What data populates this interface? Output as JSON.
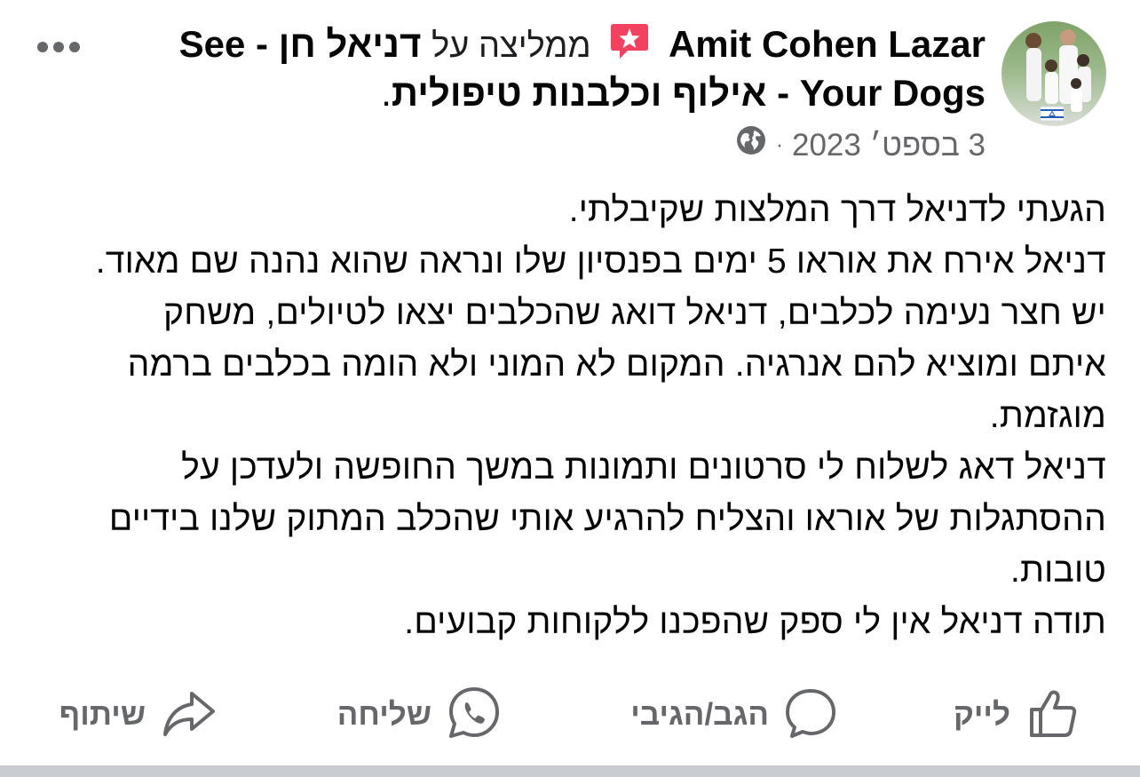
{
  "post": {
    "author": "Amit Cohen Lazar",
    "recommends": "ממליצה על",
    "page_name_line1": "דניאל חן - See",
    "page_name_line2": "Your Dogs - אילוף וכלבנות טיפולית",
    "page_name_end": ".",
    "date": "3 בספט׳ 2023",
    "separator": "·",
    "body_lines": [
      "הגעתי לדניאל דרך המלצות שקיבלתי.",
      "דניאל אירח את אוראו 5 ימים בפנסיון שלו ונראה שהוא נהנה שם מאוד.",
      "יש חצר נעימה לכלבים, דניאל דואג שהכלבים יצאו לטיולים, משחק",
      "איתם ומוציא להם אנרגיה. המקום לא המוני ולא הומה בכלבים ברמה",
      "מוגזמת.",
      "דניאל דאג לשלוח לי סרטונים ותמונות במשך החופשה ולעדכן על",
      "ההסתגלות של אוראו והצליח להרגיע אותי שהכלב המתוק שלנו בידיים",
      "טובות.",
      "תודה דניאל אין לי ספק שהפכנו ללקוחות קבועים."
    ]
  },
  "actions": {
    "like": "לייק",
    "comment": "הגב/הגיבי",
    "send": "שליחה",
    "share": "שיתוף"
  },
  "icons": {
    "recommend_badge": "recommend-star-icon",
    "privacy": "globe-icon",
    "more": "more-options-icon",
    "like": "thumbs-up-icon",
    "comment": "comment-bubble-icon",
    "send": "whatsapp-icon",
    "share": "share-arrow-icon"
  },
  "colors": {
    "badge": "#f3425f",
    "secondary_text": "#65676b",
    "primary_text": "#050505"
  }
}
